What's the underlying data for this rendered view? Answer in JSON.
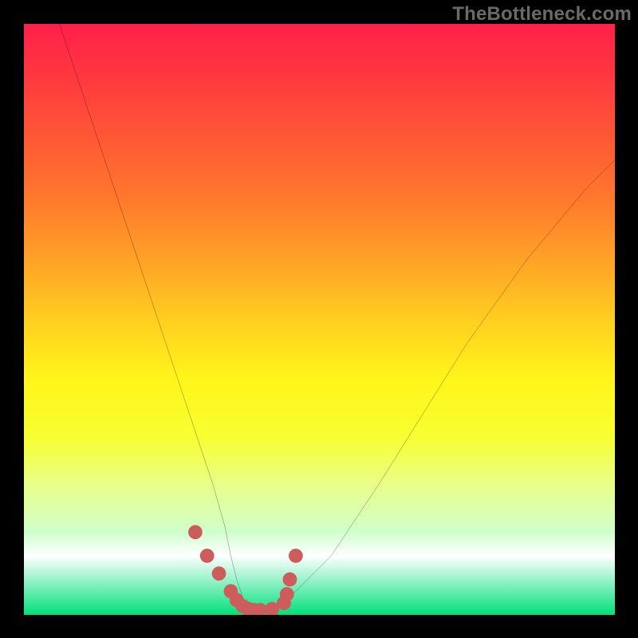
{
  "watermark": "TheBottleneck.com",
  "chart_data": {
    "type": "line",
    "title": "",
    "xlabel": "",
    "ylabel": "",
    "xlim": [
      0,
      100
    ],
    "ylim": [
      0,
      100
    ],
    "grid": false,
    "background_gradient": [
      "#ff1f4a",
      "#ff7a2d",
      "#ffce20",
      "#f8ff32",
      "#ffffff",
      "#00e07a"
    ],
    "series": [
      {
        "name": "main-curve",
        "color": "#000000",
        "x": [
          6,
          8,
          10,
          12,
          14,
          16,
          18,
          20,
          22,
          24,
          26,
          28,
          30,
          32,
          34,
          35,
          36,
          37,
          38,
          39,
          40,
          42,
          45,
          48,
          52,
          56,
          60,
          65,
          70,
          75,
          80,
          85,
          90,
          95,
          100
        ],
        "y": [
          100,
          94,
          88,
          82,
          76,
          70,
          64,
          58,
          52,
          46,
          40,
          34,
          28,
          22,
          15,
          10,
          6,
          3,
          1,
          0.5,
          0.5,
          1,
          3,
          6,
          10,
          16,
          22,
          30,
          38,
          46,
          53,
          60,
          66,
          72,
          77
        ]
      },
      {
        "name": "marker-cluster",
        "color": "#cd5c5c",
        "type": "scatter",
        "x": [
          29,
          31,
          33,
          35,
          36,
          37,
          38,
          39,
          40,
          42,
          44,
          44.5,
          45,
          46
        ],
        "y": [
          14,
          10,
          7,
          4,
          2.5,
          1.5,
          1,
          0.8,
          0.8,
          1,
          2,
          3.5,
          6,
          10
        ]
      }
    ]
  }
}
